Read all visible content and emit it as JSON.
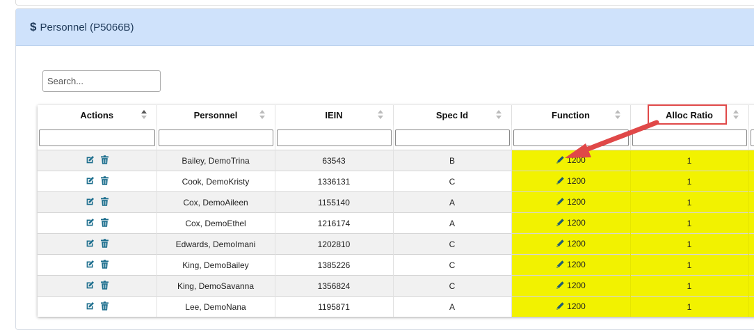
{
  "panel": {
    "title": "Personnel (P5066B)",
    "icon": "dollar-icon"
  },
  "search": {
    "placeholder": "Search...",
    "value": ""
  },
  "columns": [
    {
      "label": "Actions"
    },
    {
      "label": "Personnel"
    },
    {
      "label": "IEIN"
    },
    {
      "label": "Spec Id"
    },
    {
      "label": "Function"
    },
    {
      "label": "Alloc Ratio"
    }
  ],
  "rows": [
    {
      "personnel": "Bailey, DemoTrina",
      "iein": "63543",
      "spec_id": "B",
      "function": "1200",
      "alloc_ratio": "1"
    },
    {
      "personnel": "Cook, DemoKristy",
      "iein": "1336131",
      "spec_id": "C",
      "function": "1200",
      "alloc_ratio": "1"
    },
    {
      "personnel": "Cox, DemoAileen",
      "iein": "1155140",
      "spec_id": "A",
      "function": "1200",
      "alloc_ratio": "1"
    },
    {
      "personnel": "Cox, DemoEthel",
      "iein": "1216174",
      "spec_id": "A",
      "function": "1200",
      "alloc_ratio": "1"
    },
    {
      "personnel": "Edwards, DemoImani",
      "iein": "1202810",
      "spec_id": "C",
      "function": "1200",
      "alloc_ratio": "1"
    },
    {
      "personnel": "King, DemoBailey",
      "iein": "1385226",
      "spec_id": "C",
      "function": "1200",
      "alloc_ratio": "1"
    },
    {
      "personnel": "King, DemoSavanna",
      "iein": "1356824",
      "spec_id": "C",
      "function": "1200",
      "alloc_ratio": "1"
    },
    {
      "personnel": "Lee, DemoNana",
      "iein": "1195871",
      "spec_id": "A",
      "function": "1200",
      "alloc_ratio": "1"
    }
  ],
  "colors": {
    "header_bg": "#cfe2fb",
    "highlight": "#f2f200",
    "action_icon": "#1e6f8e",
    "callout": "#e04848"
  },
  "icons": {
    "edit": "edit-icon",
    "delete": "trash-icon",
    "function_edit": "pencil-icon"
  }
}
